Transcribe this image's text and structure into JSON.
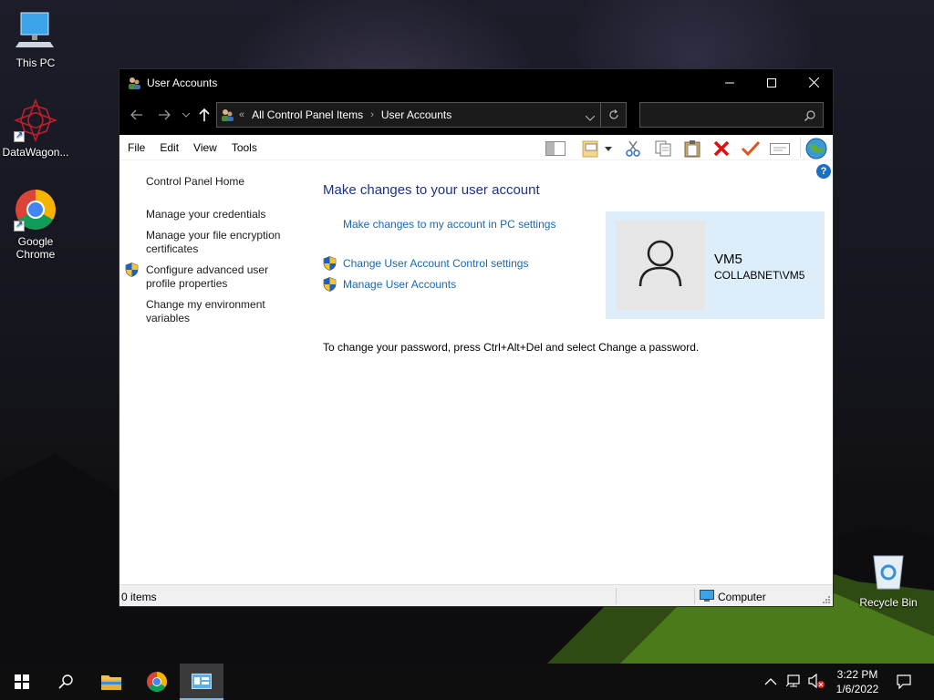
{
  "desktop": {
    "icons": [
      {
        "label": "This PC"
      },
      {
        "label": "DataWagon..."
      },
      {
        "label": "Google Chrome"
      },
      {
        "label": "Recycle Bin"
      }
    ]
  },
  "window": {
    "title": "User Accounts",
    "address": {
      "overflow": "«",
      "crumbs": [
        "All Control Panel Items",
        "User Accounts"
      ]
    },
    "search": {
      "placeholder": ""
    },
    "menu": [
      "File",
      "Edit",
      "View",
      "Tools"
    ],
    "left_pane": {
      "home": "Control Panel Home",
      "links": [
        "Manage your credentials",
        "Manage your file encryption certificates",
        "Configure advanced user profile properties",
        "Change my environment variables"
      ]
    },
    "main": {
      "title": "Make changes to your user account",
      "links": [
        "Make changes to my account in PC settings",
        "Change User Account Control settings",
        "Manage User Accounts"
      ],
      "info": "To change your password, press Ctrl+Alt+Del and select Change a password."
    },
    "user": {
      "name": "VM5",
      "domain": "COLLABNET\\VM5"
    },
    "status": {
      "items": "0 items",
      "location": "Computer"
    }
  },
  "taskbar": {
    "time": "3:22 PM",
    "date": "1/6/2022"
  },
  "colors": {
    "link": "#1668b4",
    "title": "#1e3287",
    "user_panel": "#ddeefa"
  }
}
